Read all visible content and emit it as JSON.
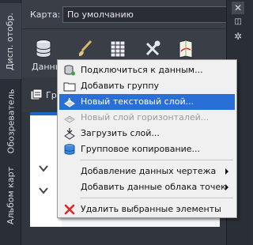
{
  "left_tabs": [
    {
      "label": "Дисп. отобр."
    },
    {
      "label": "Обозреватель"
    },
    {
      "label": "Альбом карт"
    }
  ],
  "topbar": {
    "map_label": "Карта:",
    "map_value": "По умолчанию"
  },
  "ribbon": {
    "data_label": "Данны"
  },
  "subbar": {
    "label": "Гру"
  },
  "context_menu": {
    "items": [
      {
        "label": "Подключиться к данным...",
        "icon": "database-connect-icon",
        "enabled": true
      },
      {
        "label": "Добавить группу",
        "icon": "folder-icon",
        "enabled": true
      },
      {
        "label": "Новый текстовый слой...",
        "icon": "text-layer-icon",
        "enabled": true,
        "highlighted": true
      },
      {
        "label": "Новый слой горизонталей...",
        "icon": "contour-layer-icon",
        "enabled": false
      },
      {
        "label": "Загрузить слой...",
        "icon": "load-layer-icon",
        "enabled": true
      },
      {
        "label": "Групповое копирование...",
        "icon": "batch-copy-icon",
        "enabled": true
      },
      {
        "label": "Добавление данных чертежа",
        "has_submenu": true
      },
      {
        "label": "Добавить данные облака точек",
        "has_submenu": true
      },
      {
        "label": "Удалить выбранные элементы",
        "icon": "delete-x-icon",
        "enabled": true
      }
    ]
  },
  "colors": {
    "highlight": "#2a6fd6",
    "delete_red": "#d8262b",
    "panel_blue": "#1c66c4"
  }
}
